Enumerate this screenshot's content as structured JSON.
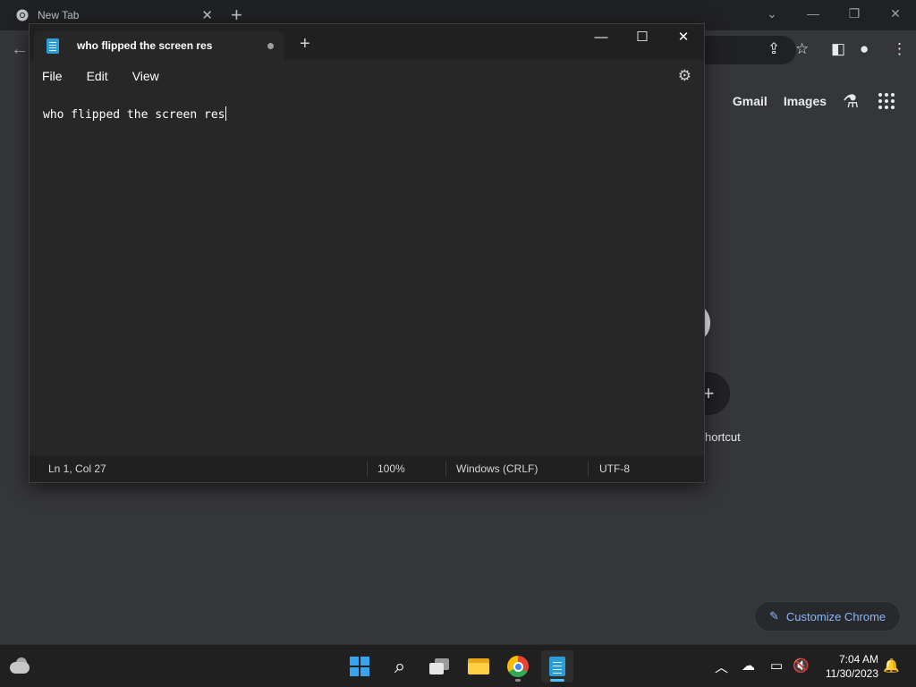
{
  "chrome": {
    "tab_title": "New Tab",
    "tab_close": "✕",
    "new_tab": "+",
    "window_controls": {
      "tab_search": "⌄",
      "minimize": "—",
      "restore": "❐",
      "close": "✕"
    },
    "back": "←",
    "toolbar_icons": {
      "share": "⇪",
      "bookmark": "☆",
      "side_panel": "◧",
      "profile": "●",
      "menu": "⋮"
    },
    "ntp": {
      "gmail": "Gmail",
      "images": "Images",
      "labs_icon": "⚗",
      "add_shortcut_icon": "+",
      "add_shortcut_label": "hortcut",
      "customize_icon": "✎",
      "customize_label": "Customize Chrome"
    }
  },
  "notepad": {
    "tab_title": "who flipped the screen res",
    "new_tab": "+",
    "window_controls": {
      "minimize": "—",
      "maximize": "☐",
      "close": "✕"
    },
    "menu": [
      "File",
      "Edit",
      "View"
    ],
    "settings_icon": "⚙",
    "content": "who flipped the screen res",
    "status": {
      "position": "Ln 1, Col 27",
      "zoom": "100%",
      "line_ending": "Windows (CRLF)",
      "encoding": "UTF-8"
    }
  },
  "taskbar": {
    "search_icon": "⌕",
    "tray": {
      "chevron": "︿",
      "onedrive": "☁",
      "display": "▭",
      "volume": "🔇"
    },
    "time": "7:04 AM",
    "date": "11/30/2023",
    "bell": "🔔"
  },
  "colors": {
    "notepad_accent": "#2b9ed8",
    "windows_accent": "#39a4ee",
    "link_blue": "#8ab4f8"
  }
}
